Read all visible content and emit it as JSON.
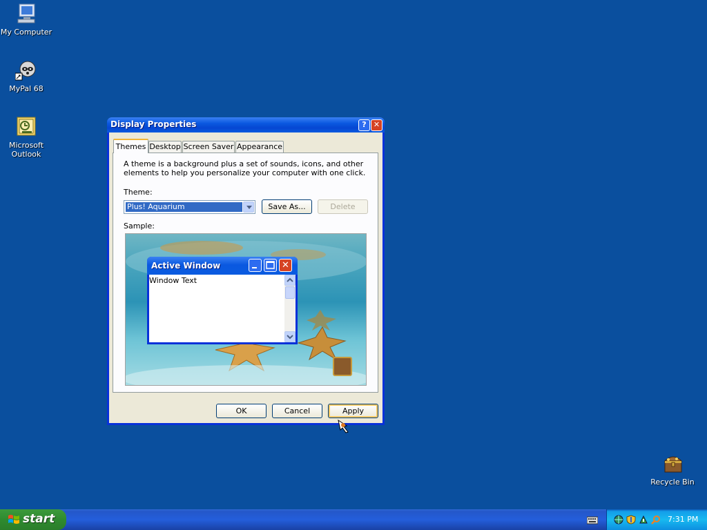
{
  "desktop": {
    "icons": [
      {
        "label": "My Computer"
      },
      {
        "label": "MyPal 68"
      },
      {
        "label": "Microsoft Outlook"
      },
      {
        "label": "Recycle Bin"
      }
    ]
  },
  "dialog": {
    "title": "Display Properties",
    "help_label": "?",
    "tabs": [
      {
        "label": "Themes"
      },
      {
        "label": "Desktop"
      },
      {
        "label": "Screen Saver"
      },
      {
        "label": "Appearance"
      }
    ],
    "description": "A theme is a background plus a set of sounds, icons, and other elements to help you personalize your computer with one click.",
    "theme_label": "Theme:",
    "theme_value": "Plus! Aquarium",
    "save_as_label": "Save As...",
    "delete_label": "Delete",
    "sample_label": "Sample:",
    "preview": {
      "window_title": "Active Window",
      "window_text": "Window Text"
    },
    "ok_label": "OK",
    "cancel_label": "Cancel",
    "apply_label": "Apply"
  },
  "taskbar": {
    "start_label": "start",
    "time": "7:31 PM"
  },
  "colors": {
    "desktop": "#0a4f9e",
    "titlebar": "#0a58e0",
    "start_button": "#2f8a2f",
    "window_face": "#ece9d8"
  }
}
